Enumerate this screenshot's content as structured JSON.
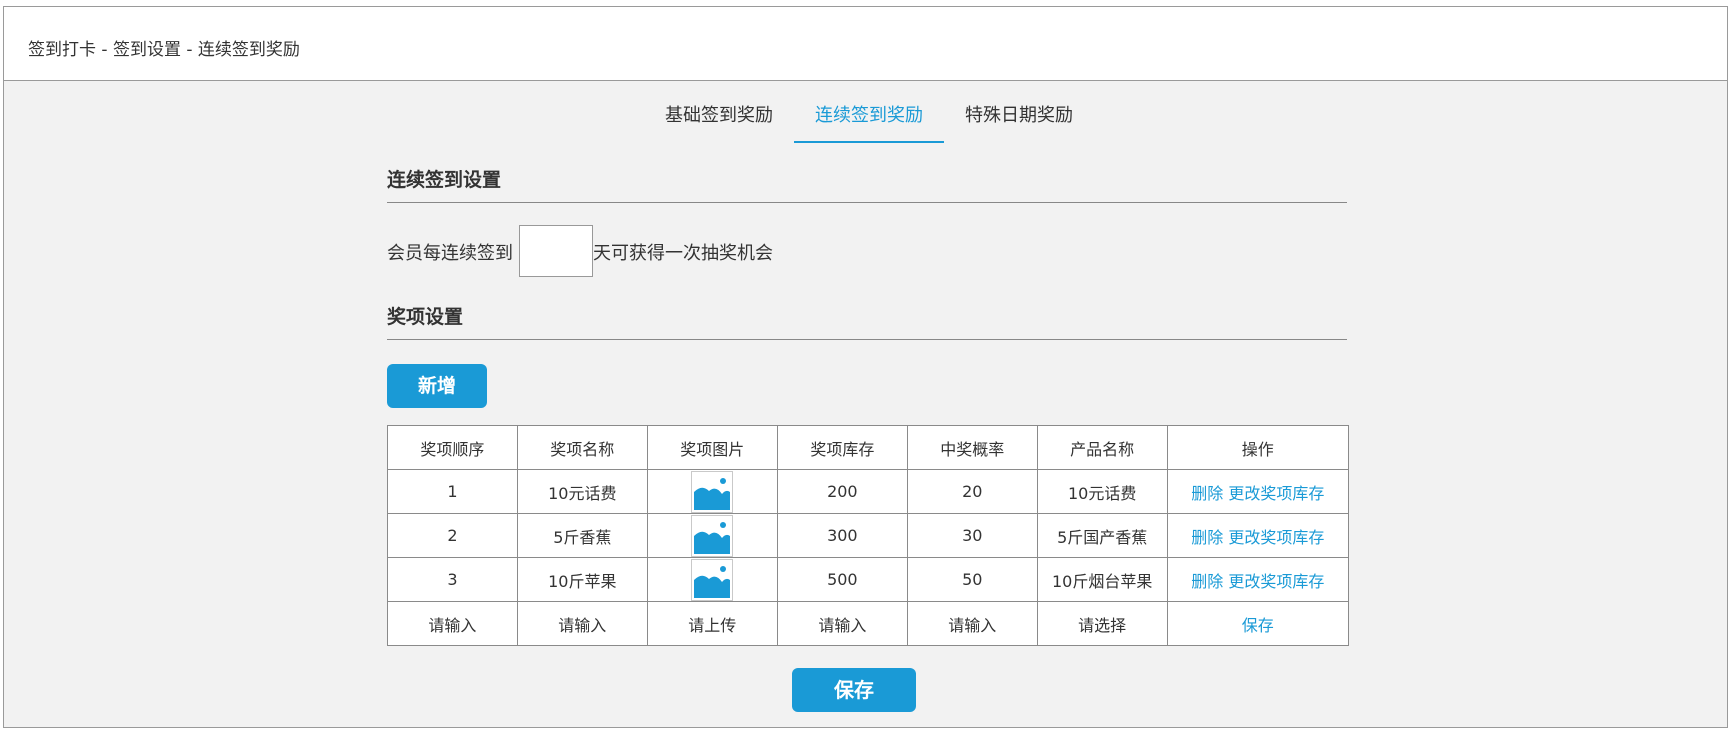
{
  "breadcrumb": "签到打卡 - 签到设置 - 连续签到奖励",
  "tabs": [
    {
      "label": "基础签到奖励",
      "active": false
    },
    {
      "label": "连续签到奖励",
      "active": true
    },
    {
      "label": "特殊日期奖励",
      "active": false
    }
  ],
  "continuous": {
    "title": "连续签到设置",
    "prefix": "会员每连续签到",
    "suffix": "天可获得一次抽奖机会",
    "days_value": ""
  },
  "prize": {
    "title": "奖项设置",
    "add_button": "新增",
    "headers": [
      "奖项顺序",
      "奖项名称",
      "奖项图片",
      "奖项库存",
      "中奖概率",
      "产品名称",
      "操作"
    ],
    "rows": [
      {
        "order": "1",
        "name": "10元话费",
        "stock": "200",
        "rate": "20",
        "product": "10元话费",
        "delete": "删除",
        "edit": "更改奖项库存"
      },
      {
        "order": "2",
        "name": "5斤香蕉",
        "stock": "300",
        "rate": "30",
        "product": "5斤国产香蕉",
        "delete": "删除",
        "edit": "更改奖项库存"
      },
      {
        "order": "3",
        "name": "10斤苹果",
        "stock": "500",
        "rate": "50",
        "product": "10斤烟台苹果",
        "delete": "删除",
        "edit": "更改奖项库存"
      }
    ],
    "new_row": {
      "order": "请输入",
      "name": "请输入",
      "image": "请上传",
      "stock": "请输入",
      "rate": "请输入",
      "product": "请选择",
      "save": "保存"
    }
  },
  "save_button": "保存",
  "icons": {
    "thumbnail": "image-placeholder-icon"
  },
  "colors": {
    "accent": "#1a9ad6",
    "image_fill": "#1a9ad6"
  }
}
